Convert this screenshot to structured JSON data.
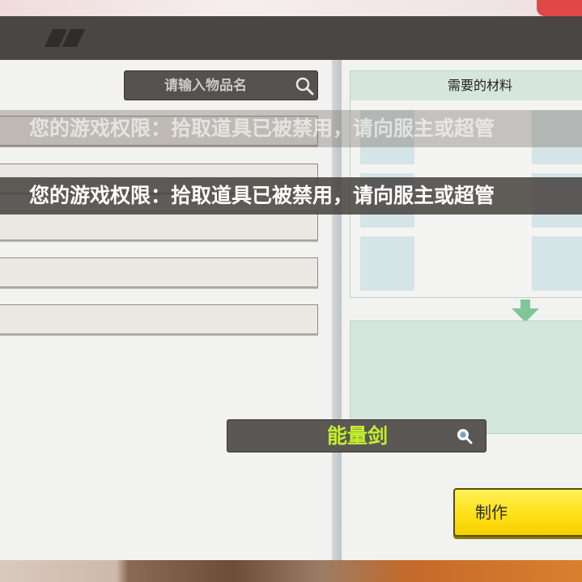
{
  "search": {
    "placeholder": "请输入物品名"
  },
  "materials": {
    "title": "需要的材料"
  },
  "selected_item": {
    "name": "能量剑"
  },
  "craft_button": {
    "label": "制作"
  },
  "notifications": [
    {
      "text": "您的游戏权限：拾取道具已被禁用，请向服主或超管"
    },
    {
      "text": "您的游戏权限：拾取道具已被禁用，请向服主或超管"
    }
  ],
  "icons": {
    "search": "search-icon",
    "arrow": "arrow-down-icon",
    "item_search": "magnify-icon"
  },
  "colors": {
    "header": "#4a4643",
    "item_name": "#c4f02c",
    "craft_button": "#ffe21a",
    "materials_header": "#d6e6dc"
  }
}
